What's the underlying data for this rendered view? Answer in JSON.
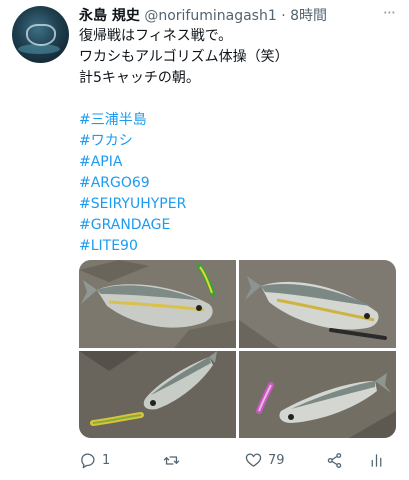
{
  "author": {
    "name": "永島 規史",
    "handle": "@norifuminagash1",
    "separator": "·",
    "time": "8時間"
  },
  "tweet": {
    "lines": [
      "復帰戦はフィネス戦で。",
      "ワカシもアルゴリズム体操（笑）",
      "計5キャッチの朝。"
    ],
    "hashtags": [
      "#三浦半島",
      "#ワカシ",
      "#APIA",
      "#ARGO69",
      "#SEIRYUHYPER",
      "#GRANDAGE",
      "#LITE90"
    ]
  },
  "actions": {
    "reply_count": "1",
    "retweet_count": "",
    "like_count": "79"
  },
  "icons": {
    "more": "more-dots-icon",
    "reply": "reply-icon",
    "retweet": "retweet-icon",
    "like": "heart-icon",
    "share": "share-icon",
    "stats": "stats-icon"
  },
  "colors": {
    "link": "#1d9bf0",
    "secondary_text": "#536471",
    "primary_text": "#0f1419"
  }
}
